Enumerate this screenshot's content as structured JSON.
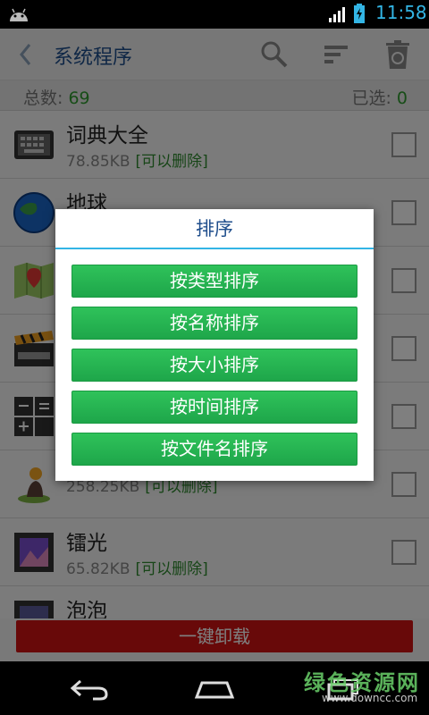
{
  "status": {
    "time": "11:58"
  },
  "actionbar": {
    "title": "系统程序"
  },
  "summary": {
    "total_label": "总数:",
    "total_value": "69",
    "selected_label": "已选:",
    "selected_value": "0"
  },
  "apps": [
    {
      "name": "词典大全",
      "size": "78.85KB",
      "tag": "[可以删除]",
      "icon": "keyboard-icon"
    },
    {
      "name": "地球",
      "size": "",
      "tag": "",
      "icon": "google-earth-icon"
    },
    {
      "name": "",
      "size": "",
      "tag": "",
      "icon": "maps-icon"
    },
    {
      "name": "",
      "size": "",
      "tag": "",
      "icon": "movie-studio-icon"
    },
    {
      "name": "",
      "size": "",
      "tag": "",
      "icon": "calculator-icon"
    },
    {
      "name": "",
      "size": "258.25KB",
      "tag": "[可以删除]",
      "icon": "latitude-icon"
    },
    {
      "name": "镭光",
      "size": "65.82KB",
      "tag": "[可以删除]",
      "icon": "gallery-icon"
    },
    {
      "name": "泡泡",
      "size": "",
      "tag": "",
      "icon": "gallery-icon"
    }
  ],
  "uninstall_label": "一键卸载",
  "dialog": {
    "title": "排序",
    "options": [
      "按类型排序",
      "按名称排序",
      "按大小排序",
      "按时间排序",
      "按文件名排序"
    ]
  },
  "watermark": {
    "main": "绿色资源网",
    "url": "www.downcc.com"
  },
  "colors": {
    "accent": "#33b5e5",
    "title_blue": "#1f4e8c",
    "button_green": "#22b04e",
    "danger_red": "#d01212"
  }
}
